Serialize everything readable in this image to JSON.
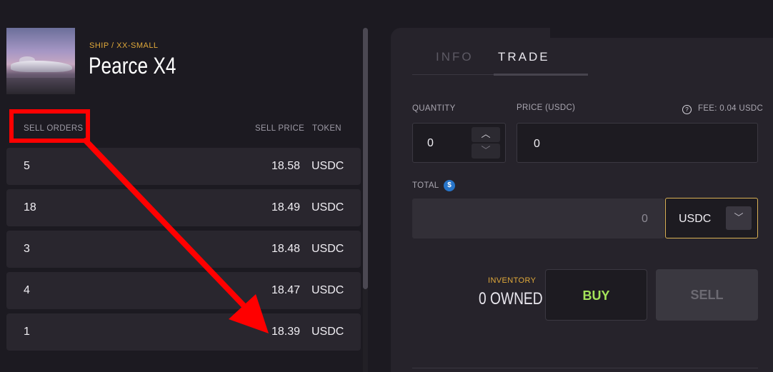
{
  "item": {
    "category": "SHIP / XX-SMALL",
    "name": "Pearce X4"
  },
  "sell_orders": {
    "headers": {
      "quantity": "SELL ORDERS",
      "price": "SELL PRICE",
      "token": "TOKEN"
    },
    "rows": [
      {
        "qty": "5",
        "price": "18.58",
        "token": "USDC"
      },
      {
        "qty": "18",
        "price": "18.49",
        "token": "USDC"
      },
      {
        "qty": "3",
        "price": "18.48",
        "token": "USDC"
      },
      {
        "qty": "4",
        "price": "18.47",
        "token": "USDC"
      },
      {
        "qty": "1",
        "price": "18.39",
        "token": "USDC"
      }
    ]
  },
  "tabs": {
    "info": "INFO",
    "trade": "TRADE",
    "active": "trade"
  },
  "trade": {
    "quantity_label": "QUANTITY",
    "quantity_value": "0",
    "price_label": "PRICE (USDC)",
    "price_value": "0",
    "fee_text": "FEE: 0.04 USDC",
    "total_label": "TOTAL",
    "total_value": "0",
    "currency_selected": "USDC",
    "inventory_label": "INVENTORY",
    "inventory_owned": "0 OWNED",
    "buy_label": "BUY",
    "sell_label": "SELL"
  },
  "colors": {
    "background": "#1c1a21",
    "accent_orange": "#e0a93a",
    "buy_green": "#a4e35a",
    "annotation_red": "#ff0000",
    "usdc_blue": "#2775ca"
  }
}
